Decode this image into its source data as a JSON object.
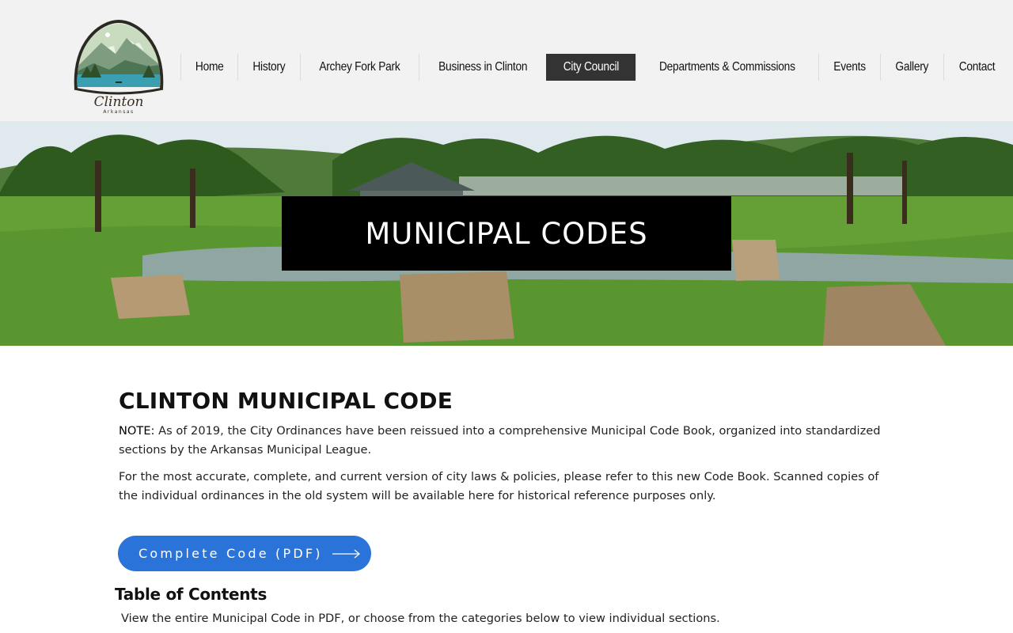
{
  "header": {
    "logo": {
      "text_main": "Clinton",
      "text_sub": "Arkansas",
      "colors": {
        "ring": "#2b2a22",
        "sky": "#bcd3b0",
        "mountain": "#6b8f6a",
        "water": "#3a9fb0",
        "text": "#3b2e1e"
      }
    },
    "nav": [
      {
        "label": "Home",
        "active": false
      },
      {
        "label": "History",
        "active": false
      },
      {
        "label": "Archey Fork Park",
        "active": false
      },
      {
        "label": "Business in Clinton",
        "active": false
      },
      {
        "label": "City Council",
        "active": true
      },
      {
        "label": "Departments & Commissions",
        "active": false
      },
      {
        "label": "Events",
        "active": false
      },
      {
        "label": "Gallery",
        "active": false
      },
      {
        "label": "Contact",
        "active": false
      }
    ]
  },
  "hero": {
    "title": "MUNICIPAL CODES",
    "image_description_colors": {
      "grass": "#5f9a2e",
      "trees": "#2f5a1e",
      "sky": "#dfe9ee",
      "pond": "#8fa6a3",
      "rock": "#b59a74"
    }
  },
  "main": {
    "title": "CLINTON MUNICIPAL CODE",
    "note_label": "NOTE:",
    "note_text": "  As of 2019, the City Ordinances have been reissued into a comprehensive Municipal Code Book, organized into standardized sections by the Arkansas Municipal League.",
    "para2": "For the most accurate, complete, and current version of city laws & policies, please refer to this new Code Book. Scanned copies of the individual ordinances in the old system will be available here for historical reference purposes only.",
    "pdf_button_label": "Complete Code (PDF)",
    "pdf_button_color": "#2a73d9",
    "toc_title": "Table of Contents",
    "toc_desc": "View the entire Municipal Code in PDF, or choose from the categories below to view individual sections."
  }
}
